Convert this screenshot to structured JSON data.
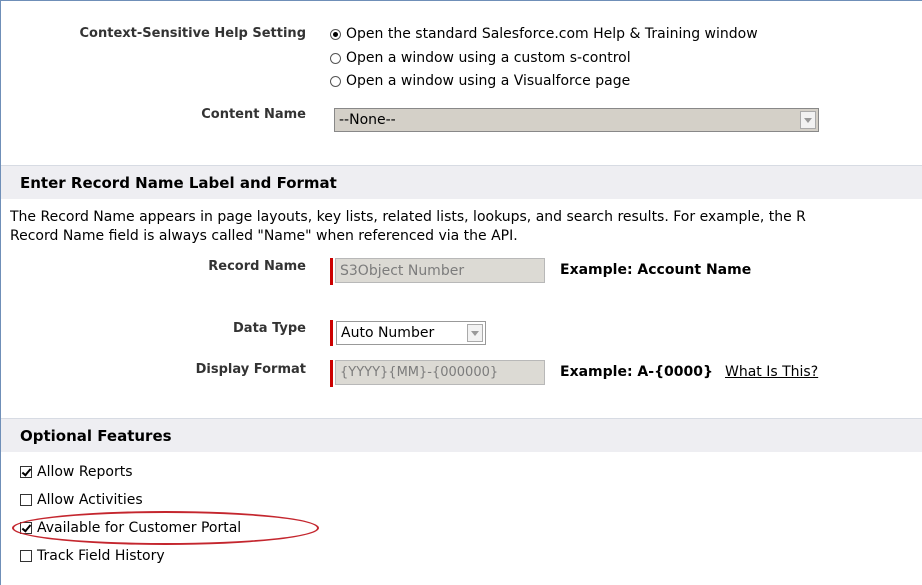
{
  "help_setting": {
    "label": "Context-Sensitive Help Setting",
    "options": [
      {
        "label": "Open the standard Salesforce.com Help & Training window",
        "selected": true
      },
      {
        "label": "Open a window using a custom s-control",
        "selected": false
      },
      {
        "label": "Open a window using a Visualforce page",
        "selected": false
      }
    ]
  },
  "content_name": {
    "label": "Content Name",
    "value": "--None--"
  },
  "record_section": {
    "title": "Enter Record Name Label and Format",
    "description_line1": "The Record Name appears in page layouts, key lists, related lists, lookups, and search results. For example, the R",
    "description_line2": "Record Name field is always called \"Name\" when referenced via the API.",
    "record_name": {
      "label": "Record Name",
      "value": "S3Object Number",
      "example": "Example:  Account Name"
    },
    "data_type": {
      "label": "Data Type",
      "value": "Auto Number"
    },
    "display_format": {
      "label": "Display Format",
      "value": "{YYYY}{MM}-{000000}",
      "example": "Example:  A-{0000}",
      "link": "What Is This?"
    }
  },
  "optional_section": {
    "title": "Optional Features",
    "features": [
      {
        "label": "Allow Reports",
        "checked": true
      },
      {
        "label": "Allow Activities",
        "checked": false
      },
      {
        "label": "Available for Customer Portal",
        "checked": true
      },
      {
        "label": "Track Field History",
        "checked": false
      }
    ]
  },
  "colors": {
    "highlight": "#c4262e",
    "required_bar": "#cc0000",
    "section_bg": "#eeeef2"
  }
}
